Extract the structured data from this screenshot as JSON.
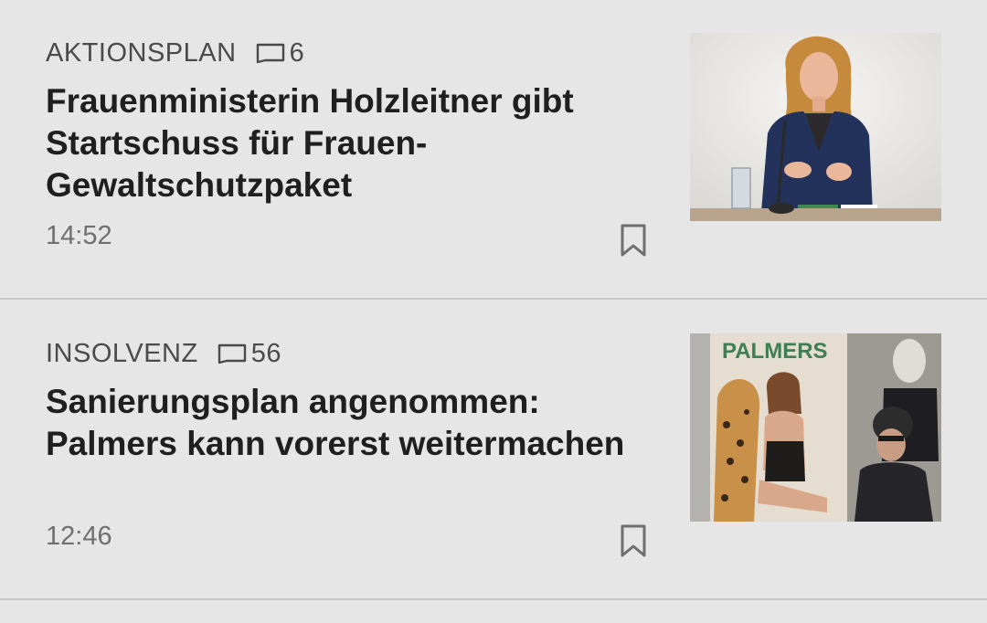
{
  "articles": [
    {
      "kicker": "AKTIONSPLAN",
      "comment_count": "6",
      "headline": "Frauenministerin Holzleitner gibt Startschuss für Frauen-Gewaltschutzpaket",
      "time": "14:52",
      "icons": {
        "comments": "comment-bubble-icon",
        "bookmark": "bookmark-icon"
      }
    },
    {
      "kicker": "INSOLVENZ",
      "comment_count": "56",
      "headline": "Sanierungsplan angenommen: Palmers kann vorerst weitermachen",
      "time": "12:46",
      "image_text": "PALMERS",
      "icons": {
        "comments": "comment-bubble-icon",
        "bookmark": "bookmark-icon"
      }
    }
  ],
  "colors": {
    "background": "#e6e6e6",
    "divider": "#c8c8c8",
    "headline": "#1f1f1f",
    "kicker": "#4a4a4a",
    "time": "#6f6f6f",
    "brand_green": "#3f7d52"
  }
}
